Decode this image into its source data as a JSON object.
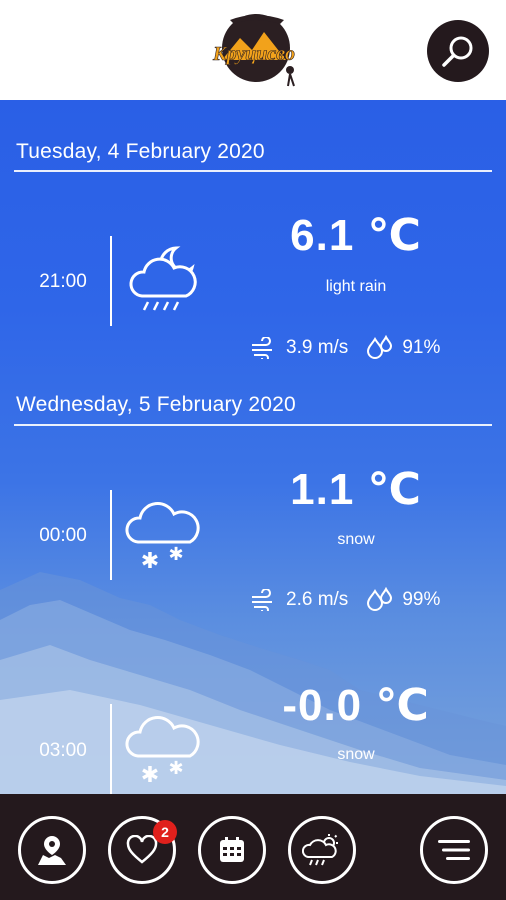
{
  "header": {
    "logo_text": "Круцисво",
    "search_icon": "search-icon"
  },
  "forecast": [
    {
      "date": "Tuesday, 4 February 2020",
      "hours": [
        {
          "time": "21:00",
          "icon": "cloud-moon-rain-icon",
          "temp": "6.1 ℃",
          "condition": "light rain",
          "wind": "3.9 m/s",
          "humidity": "91%"
        }
      ]
    },
    {
      "date": "Wednesday, 5 February 2020",
      "hours": [
        {
          "time": "00:00",
          "icon": "cloud-snow-icon",
          "temp": "1.1 ℃",
          "condition": "snow",
          "wind": "2.6 m/s",
          "humidity": "99%"
        },
        {
          "time": "03:00",
          "icon": "cloud-snow-icon",
          "temp": "-0.0 ℃",
          "condition": "snow"
        }
      ]
    }
  ],
  "bottom_nav": {
    "items": [
      "map-pin-icon",
      "heart-icon",
      "calendar-icon",
      "cloud-sun-rain-icon",
      "menu-icon"
    ],
    "favorites_badge": "2"
  },
  "colors": {
    "dark": "#24191d",
    "sky_blue": "#2f66e8",
    "badge_red": "#e0201c"
  }
}
